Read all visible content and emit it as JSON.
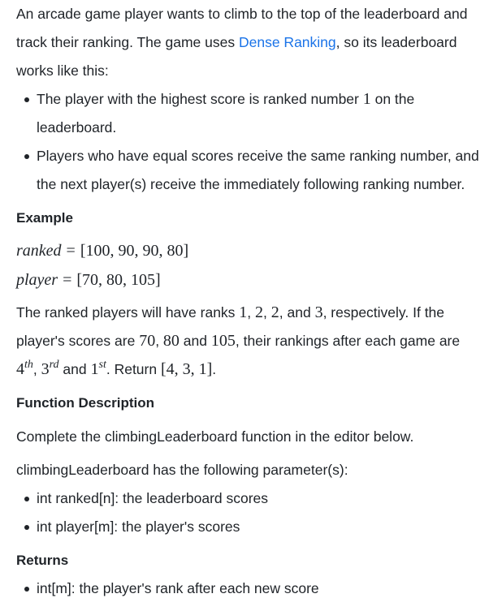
{
  "intro": {
    "text_before_link": "An arcade game player wants to climb to the top of the leaderboard and track their ranking. The game uses ",
    "link_text": "Dense Ranking",
    "text_after_link": ", so its leaderboard works like this:"
  },
  "rules": [
    {
      "before": "The player with the highest score is ranked number ",
      "math": "1",
      "after": " on the leaderboard."
    },
    {
      "text": "Players who have equal scores receive the same ranking number, and the next player(s) receive the immediately following ranking number."
    }
  ],
  "example": {
    "heading": "Example",
    "ranked_name": "ranked",
    "ranked_value": "[100, 90, 90, 80]",
    "player_name": "player",
    "player_value": "[70, 80, 105]",
    "equals": "=",
    "explanation": {
      "t1": "The ranked players will have ranks ",
      "m1": "1",
      "t2": ", ",
      "m2": "2",
      "t3": ", ",
      "m3": "2",
      "t4": ", and ",
      "m4": "3",
      "t5": ", respectively. If the player's scores are ",
      "m5": "70",
      "t6": ", ",
      "m6": "80",
      "t7": " and ",
      "m7": "105",
      "t8": ", their rankings after each game are ",
      "r1": "4",
      "r1sup": "th",
      "t9": ", ",
      "r2": "3",
      "r2sup": "rd",
      "t10": " and ",
      "r3": "1",
      "r3sup": "st",
      "t11": ". Return ",
      "m8": "[4, 3, 1]",
      "t12": "."
    }
  },
  "function_description": {
    "heading": "Function Description",
    "line1": "Complete the climbingLeaderboard function in the editor below.",
    "line2": "climbingLeaderboard has the following parameter(s):",
    "params": [
      "int ranked[n]: the leaderboard scores",
      "int player[m]: the player's scores"
    ]
  },
  "returns": {
    "heading": "Returns",
    "items": [
      "int[m]: the player's rank after each new score"
    ]
  }
}
